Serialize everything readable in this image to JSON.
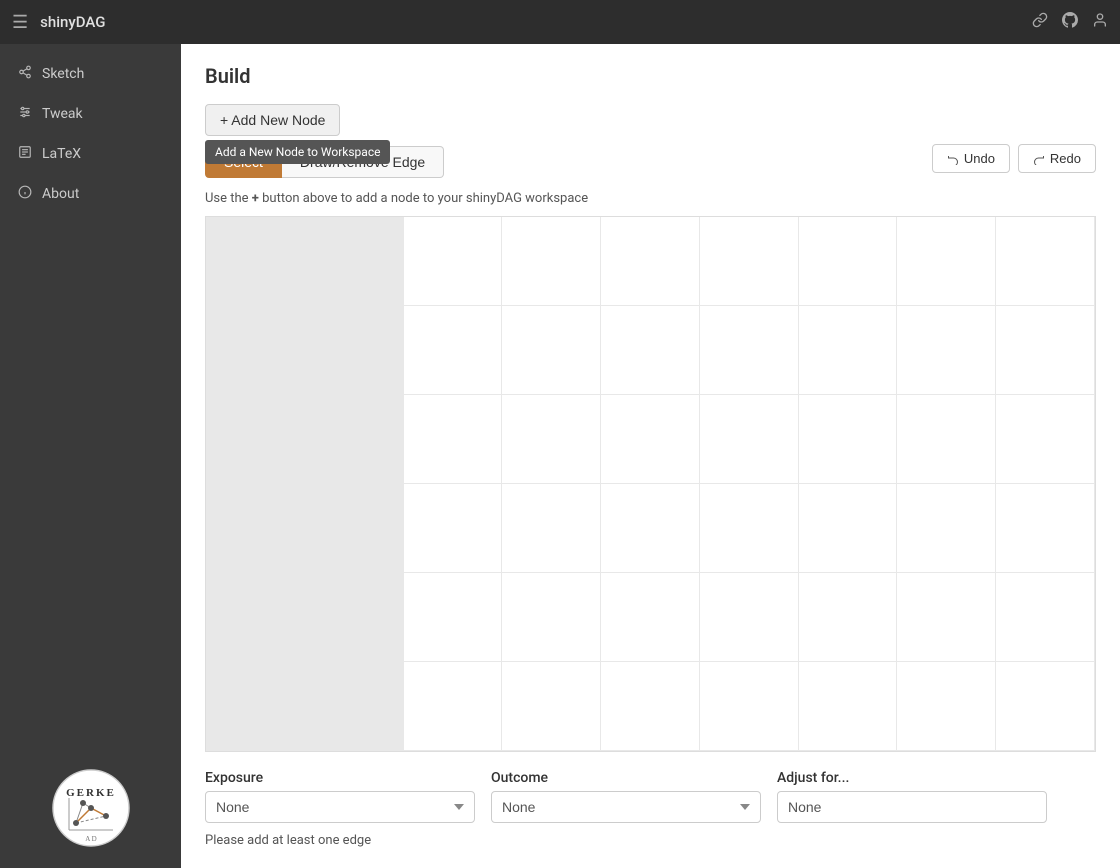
{
  "app": {
    "title": "shinyDAG"
  },
  "topbar": {
    "hamburger_icon": "≡",
    "link_icon": "🔗",
    "github_icon": "⊙",
    "user_icon": "👤"
  },
  "sidebar": {
    "items": [
      {
        "id": "sketch",
        "label": "Sketch",
        "icon": "share"
      },
      {
        "id": "tweak",
        "label": "Tweak",
        "icon": "sliders"
      },
      {
        "id": "latex",
        "label": "LaTeX",
        "icon": "file"
      },
      {
        "id": "about",
        "label": "About",
        "icon": "info"
      }
    ],
    "active": "sketch"
  },
  "main": {
    "page_title": "Build",
    "add_node_label": "+ Add New Node",
    "tooltip_text": "Add a New Node to Workspace",
    "mode_buttons": [
      {
        "id": "select",
        "label": "Select",
        "active": true
      },
      {
        "id": "draw_remove",
        "label": "Draw/Remove Edge",
        "active": false
      }
    ],
    "undo_label": "↺ Undo",
    "redo_label": "↻ Redo",
    "instruction_text": "Use the + button above to add a node to your shinyDAG workspace",
    "plus_symbol": "+",
    "exposure": {
      "label": "Exposure",
      "value": "None",
      "options": [
        "None"
      ]
    },
    "outcome": {
      "label": "Outcome",
      "value": "None",
      "options": [
        "None"
      ]
    },
    "adjust_for": {
      "label": "Adjust for...",
      "value": "None",
      "placeholder": "None"
    },
    "validation_text": "Please add at least one edge"
  }
}
